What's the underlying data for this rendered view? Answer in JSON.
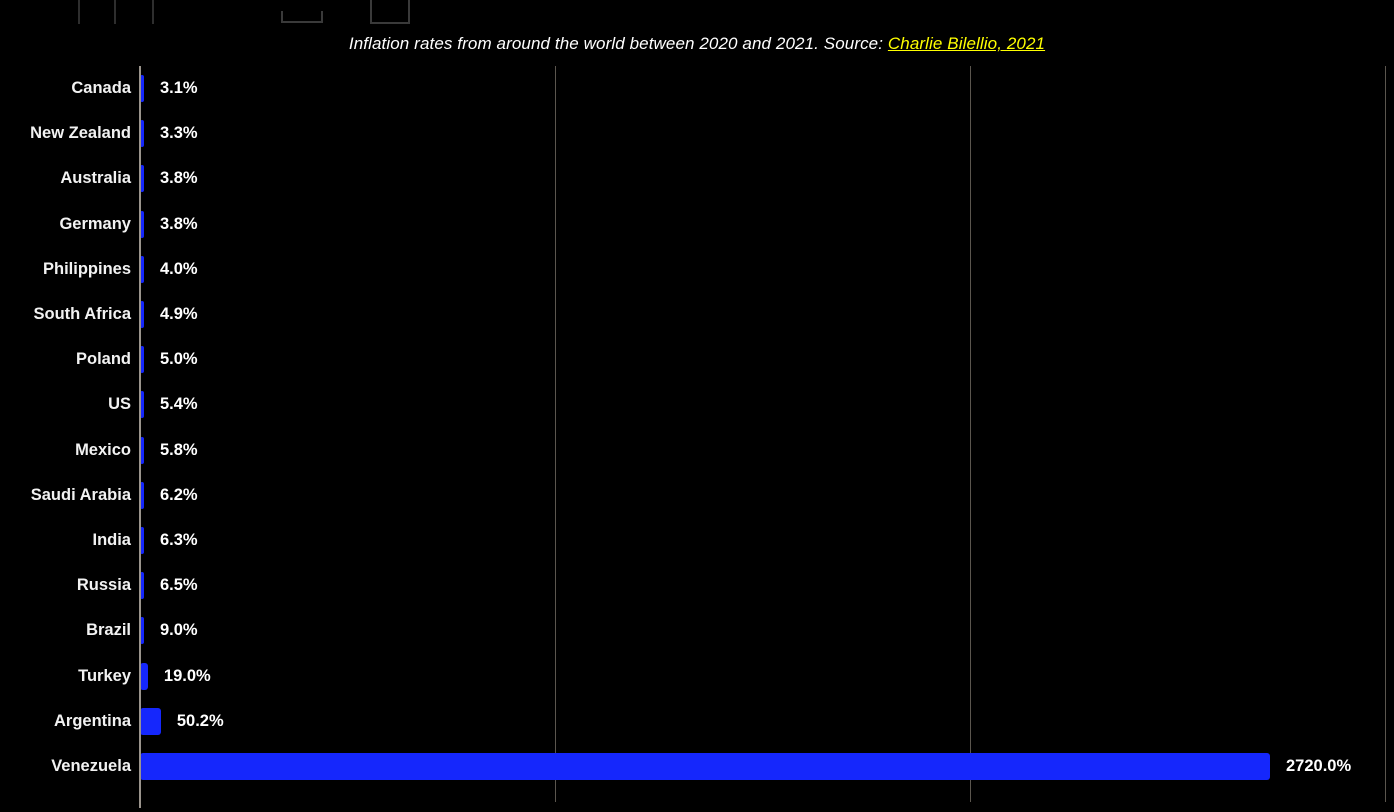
{
  "window_chrome": {
    "tab_placeholder": "",
    "minimize_label": "",
    "maximize_label": ""
  },
  "subtitle": {
    "text_before": "Inflation rates from around the world between 2020 and 2021. Source: ",
    "source_link": "Charlie Bilellio, 2021",
    "full_text": "Inflation rates from around the world between 2020 and 2021. Source: Charlie Bilellio, 2021"
  },
  "colors": {
    "background": "#000000",
    "bar": "#1527fc",
    "text": "#ffffff",
    "link": "#ffff00",
    "gridline": "#5b564e",
    "axis": "#9a948c"
  },
  "chart_data": {
    "type": "bar",
    "orientation": "horizontal",
    "title": "",
    "subtitle": "Inflation rates from around the world between 2020 and 2021. Source: Charlie Bilellio, 2021",
    "xlabel": "",
    "ylabel": "",
    "xlim": [
      0,
      2720
    ],
    "grid": true,
    "gridlines_x": [
      0,
      1000,
      2000,
      3000
    ],
    "legend": "none",
    "value_suffix": "%",
    "categories": [
      "Canada",
      "New Zealand",
      "Australia",
      "Germany",
      "Philippines",
      "South Africa",
      "Poland",
      "US",
      "Mexico",
      "Saudi Arabia",
      "India",
      "Russia",
      "Brazil",
      "Turkey",
      "Argentina",
      "Venezuela"
    ],
    "values": [
      3.1,
      3.3,
      3.8,
      3.8,
      4.0,
      4.9,
      5.0,
      5.4,
      5.8,
      6.2,
      6.3,
      6.5,
      9.0,
      19.0,
      50.2,
      2720.0
    ],
    "value_labels": [
      "3.1%",
      "3.3%",
      "3.8%",
      "3.8%",
      "4.0%",
      "4.9%",
      "5.0%",
      "5.4%",
      "5.8%",
      "6.2%",
      "6.3%",
      "6.5%",
      "9.0%",
      "19.0%",
      "50.2%",
      "2720.0%"
    ]
  }
}
